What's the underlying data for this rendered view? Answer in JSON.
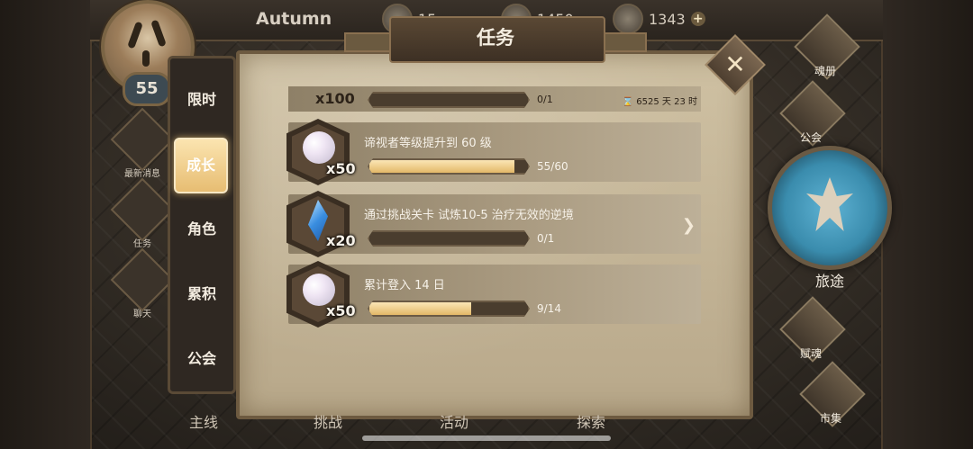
{
  "player": {
    "name": "Autumn",
    "level": "55"
  },
  "resources": [
    {
      "icon": "coin-icon",
      "value": "15"
    },
    {
      "icon": "crystal-icon",
      "value": "1450"
    },
    {
      "icon": "diamond-icon",
      "value": "1343"
    }
  ],
  "left_shortcuts": [
    {
      "label": "最新消息",
      "icon": "news-icon"
    },
    {
      "label": "任务",
      "icon": "quest-icon"
    },
    {
      "label": "聊天",
      "icon": "chat-icon"
    }
  ],
  "tabs": [
    {
      "label": "限时"
    },
    {
      "label": "成长"
    },
    {
      "label": "角色"
    },
    {
      "label": "累积"
    },
    {
      "label": "公会"
    }
  ],
  "panel": {
    "title": "任务"
  },
  "partial_quest": {
    "qty": "x100",
    "progress_text": "0/1",
    "progress": 0,
    "timer": "6525 天 23 时"
  },
  "quests": [
    {
      "title": "谛视者等级提升到 60 级",
      "qty": "x50",
      "progress_text": "55/60",
      "progress": 0.9167,
      "reward": "pearl"
    },
    {
      "title": "通过挑战关卡 试炼10-5 治疗无效的逆境",
      "qty": "x20",
      "progress_text": "0/1",
      "progress": 0,
      "reward": "blue-crystal"
    },
    {
      "title": "累计登入 14 日",
      "qty": "x50",
      "progress_text": "9/14",
      "progress": 0.6429,
      "reward": "pearl"
    }
  ],
  "right_nav": [
    {
      "label": "魂册"
    },
    {
      "label": "公会"
    },
    {
      "label": "旅途"
    },
    {
      "label": "赋魂"
    },
    {
      "label": "市集"
    }
  ],
  "bottom_nav": [
    {
      "label": "主线"
    },
    {
      "label": "挑战"
    },
    {
      "label": "活动"
    },
    {
      "label": "探索"
    }
  ]
}
